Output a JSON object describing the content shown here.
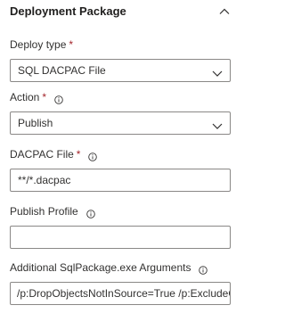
{
  "section": {
    "title": "Deployment Package",
    "collapse_icon": "chevron-up-icon"
  },
  "fields": {
    "deploy_type": {
      "label": "Deploy type",
      "required_mark": "*",
      "value": "SQL DACPAC File"
    },
    "action": {
      "label": "Action",
      "required_mark": "*",
      "info_icon": "info-icon",
      "value": "Publish"
    },
    "dacpac_file": {
      "label": "DACPAC File",
      "required_mark": "*",
      "info_icon": "info-icon",
      "value": "**/*.dacpac"
    },
    "publish_profile": {
      "label": "Publish Profile",
      "info_icon": "info-icon",
      "value": ""
    },
    "additional_args": {
      "label": "Additional SqlPackage.exe Arguments",
      "info_icon": "info-icon",
      "value": "/p:DropObjectsNotInSource=True /p:ExcludeObjectTypes=Users;Logins;RoleMembership"
    }
  },
  "colors": {
    "required": "#a4262c",
    "border": "#8a8886",
    "text": "#323130"
  }
}
